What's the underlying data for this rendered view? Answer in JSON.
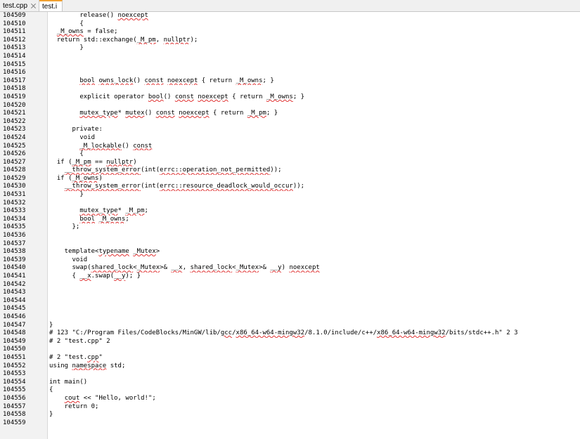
{
  "tabs": [
    {
      "label": "test.cpp",
      "active": false
    },
    {
      "label": "test.i",
      "active": true
    }
  ],
  "lines": [
    {
      "n": "104509",
      "t": [
        {
          "s": "        release() "
        },
        {
          "s": "noexcept",
          "u": true
        }
      ]
    },
    {
      "n": "104510",
      "t": [
        {
          "s": "        {"
        }
      ]
    },
    {
      "n": "104511",
      "t": [
        {
          "s": "  "
        },
        {
          "s": "_M_owns",
          "u": true
        },
        {
          "s": " = false;"
        }
      ]
    },
    {
      "n": "104512",
      "t": [
        {
          "s": "  return std::exchange("
        },
        {
          "s": "_M_pm",
          "u": true
        },
        {
          "s": ", "
        },
        {
          "s": "nullptr",
          "u": true
        },
        {
          "s": ");"
        }
      ]
    },
    {
      "n": "104513",
      "t": [
        {
          "s": "        }"
        }
      ]
    },
    {
      "n": "104514",
      "t": []
    },
    {
      "n": "104515",
      "t": []
    },
    {
      "n": "104516",
      "t": []
    },
    {
      "n": "104517",
      "t": [
        {
          "s": "        "
        },
        {
          "s": "bool",
          "u": true
        },
        {
          "s": " "
        },
        {
          "s": "owns_lock",
          "u": true
        },
        {
          "s": "() "
        },
        {
          "s": "const",
          "u": true
        },
        {
          "s": " "
        },
        {
          "s": "noexcept",
          "u": true
        },
        {
          "s": " { return "
        },
        {
          "s": "_M_owns",
          "u": true
        },
        {
          "s": "; }"
        }
      ]
    },
    {
      "n": "104518",
      "t": []
    },
    {
      "n": "104519",
      "t": [
        {
          "s": "        explicit operator "
        },
        {
          "s": "bool",
          "u": true
        },
        {
          "s": "() "
        },
        {
          "s": "const",
          "u": true
        },
        {
          "s": " "
        },
        {
          "s": "noexcept",
          "u": true
        },
        {
          "s": " { return "
        },
        {
          "s": "_M_owns",
          "u": true
        },
        {
          "s": "; }"
        }
      ]
    },
    {
      "n": "104520",
      "t": []
    },
    {
      "n": "104521",
      "t": [
        {
          "s": "        "
        },
        {
          "s": "mutex_type",
          "u": true
        },
        {
          "s": "* "
        },
        {
          "s": "mutex",
          "u": true
        },
        {
          "s": "() "
        },
        {
          "s": "const",
          "u": true
        },
        {
          "s": " "
        },
        {
          "s": "noexcept",
          "u": true
        },
        {
          "s": " { return "
        },
        {
          "s": "_M_pm",
          "u": true
        },
        {
          "s": "; }"
        }
      ]
    },
    {
      "n": "104522",
      "t": []
    },
    {
      "n": "104523",
      "t": [
        {
          "s": "      private:"
        }
      ]
    },
    {
      "n": "104524",
      "t": [
        {
          "s": "        void"
        }
      ]
    },
    {
      "n": "104525",
      "t": [
        {
          "s": "        "
        },
        {
          "s": "_M_lockable",
          "u": true
        },
        {
          "s": "() "
        },
        {
          "s": "const",
          "u": true
        }
      ]
    },
    {
      "n": "104526",
      "t": [
        {
          "s": "        {"
        }
      ]
    },
    {
      "n": "104527",
      "t": [
        {
          "s": "  if ("
        },
        {
          "s": "_M_pm",
          "u": true
        },
        {
          "s": " == "
        },
        {
          "s": "nullptr",
          "u": true
        },
        {
          "s": ")"
        }
      ]
    },
    {
      "n": "104528",
      "t": [
        {
          "s": "    "
        },
        {
          "s": "__throw_system_error",
          "u": true
        },
        {
          "s": "(int("
        },
        {
          "s": "errc::operation_not_permitted",
          "u": true
        },
        {
          "s": "));"
        }
      ]
    },
    {
      "n": "104529",
      "t": [
        {
          "s": "  if ("
        },
        {
          "s": "_M_owns",
          "u": true
        },
        {
          "s": ")"
        }
      ]
    },
    {
      "n": "104530",
      "t": [
        {
          "s": "    "
        },
        {
          "s": "__throw_system_error",
          "u": true
        },
        {
          "s": "(int("
        },
        {
          "s": "errc::resource_deadlock_would_occur",
          "u": true
        },
        {
          "s": "));"
        }
      ]
    },
    {
      "n": "104531",
      "t": [
        {
          "s": "        }"
        }
      ]
    },
    {
      "n": "104532",
      "t": []
    },
    {
      "n": "104533",
      "t": [
        {
          "s": "        "
        },
        {
          "s": "mutex_type",
          "u": true
        },
        {
          "s": "* "
        },
        {
          "s": "_M_pm",
          "u": true
        },
        {
          "s": ";"
        }
      ]
    },
    {
      "n": "104534",
      "t": [
        {
          "s": "        "
        },
        {
          "s": "bool",
          "u": true
        },
        {
          "s": " "
        },
        {
          "s": "_M_owns",
          "u": true
        },
        {
          "s": ";"
        }
      ]
    },
    {
      "n": "104535",
      "t": [
        {
          "s": "      };"
        }
      ]
    },
    {
      "n": "104536",
      "t": []
    },
    {
      "n": "104537",
      "t": []
    },
    {
      "n": "104538",
      "t": [
        {
          "s": "    template<"
        },
        {
          "s": "typename",
          "u": true
        },
        {
          "s": " "
        },
        {
          "s": "_Mutex",
          "u": true
        },
        {
          "s": ">"
        }
      ]
    },
    {
      "n": "104539",
      "t": [
        {
          "s": "      void"
        }
      ]
    },
    {
      "n": "104540",
      "t": [
        {
          "s": "      swap("
        },
        {
          "s": "shared_lock",
          "u": true
        },
        {
          "s": "<"
        },
        {
          "s": "_Mutex",
          "u": true
        },
        {
          "s": ">& "
        },
        {
          "s": "__x",
          "u": true
        },
        {
          "s": ", "
        },
        {
          "s": "shared_lock",
          "u": true
        },
        {
          "s": "<"
        },
        {
          "s": "_Mutex",
          "u": true
        },
        {
          "s": ">& "
        },
        {
          "s": "__y",
          "u": true
        },
        {
          "s": ") "
        },
        {
          "s": "noexcept",
          "u": true
        }
      ]
    },
    {
      "n": "104541",
      "t": [
        {
          "s": "      { "
        },
        {
          "s": "__x",
          "u": true
        },
        {
          "s": ".swap("
        },
        {
          "s": "__y",
          "u": true
        },
        {
          "s": "); }"
        }
      ]
    },
    {
      "n": "104542",
      "t": []
    },
    {
      "n": "104543",
      "t": []
    },
    {
      "n": "104544",
      "t": []
    },
    {
      "n": "104545",
      "t": []
    },
    {
      "n": "104546",
      "t": []
    },
    {
      "n": "104547",
      "t": [
        {
          "s": "}"
        }
      ]
    },
    {
      "n": "104548",
      "t": [
        {
          "s": "# 123 \"C:/Program Files/CodeBlocks/MinGW/lib/"
        },
        {
          "s": "gcc",
          "u": true
        },
        {
          "s": "/"
        },
        {
          "s": "x86_64-w64-mingw32",
          "u": true
        },
        {
          "s": "/8.1.0/include/c++/"
        },
        {
          "s": "x86_64-w64-mingw32",
          "u": true
        },
        {
          "s": "/bits/stdc++.h\" 2 3"
        }
      ]
    },
    {
      "n": "104549",
      "t": [
        {
          "s": "# 2 \"test.cpp\" 2"
        }
      ]
    },
    {
      "n": "104550",
      "t": []
    },
    {
      "n": "104551",
      "t": [
        {
          "s": "# 2 \"test."
        },
        {
          "s": "cpp",
          "u": true
        },
        {
          "s": "\""
        }
      ]
    },
    {
      "n": "104552",
      "t": [
        {
          "s": "using "
        },
        {
          "s": "namespace",
          "u": true
        },
        {
          "s": " std;"
        }
      ]
    },
    {
      "n": "104553",
      "t": []
    },
    {
      "n": "104554",
      "t": [
        {
          "s": "int main()"
        }
      ]
    },
    {
      "n": "104555",
      "t": [
        {
          "s": "{"
        }
      ]
    },
    {
      "n": "104556",
      "t": [
        {
          "s": "    "
        },
        {
          "s": "cout",
          "u": true
        },
        {
          "s": " << \"Hello, world!\";"
        }
      ]
    },
    {
      "n": "104557",
      "t": [
        {
          "s": "    return 0;"
        }
      ]
    },
    {
      "n": "104558",
      "t": [
        {
          "s": "}"
        }
      ]
    },
    {
      "n": "104559",
      "t": []
    }
  ]
}
